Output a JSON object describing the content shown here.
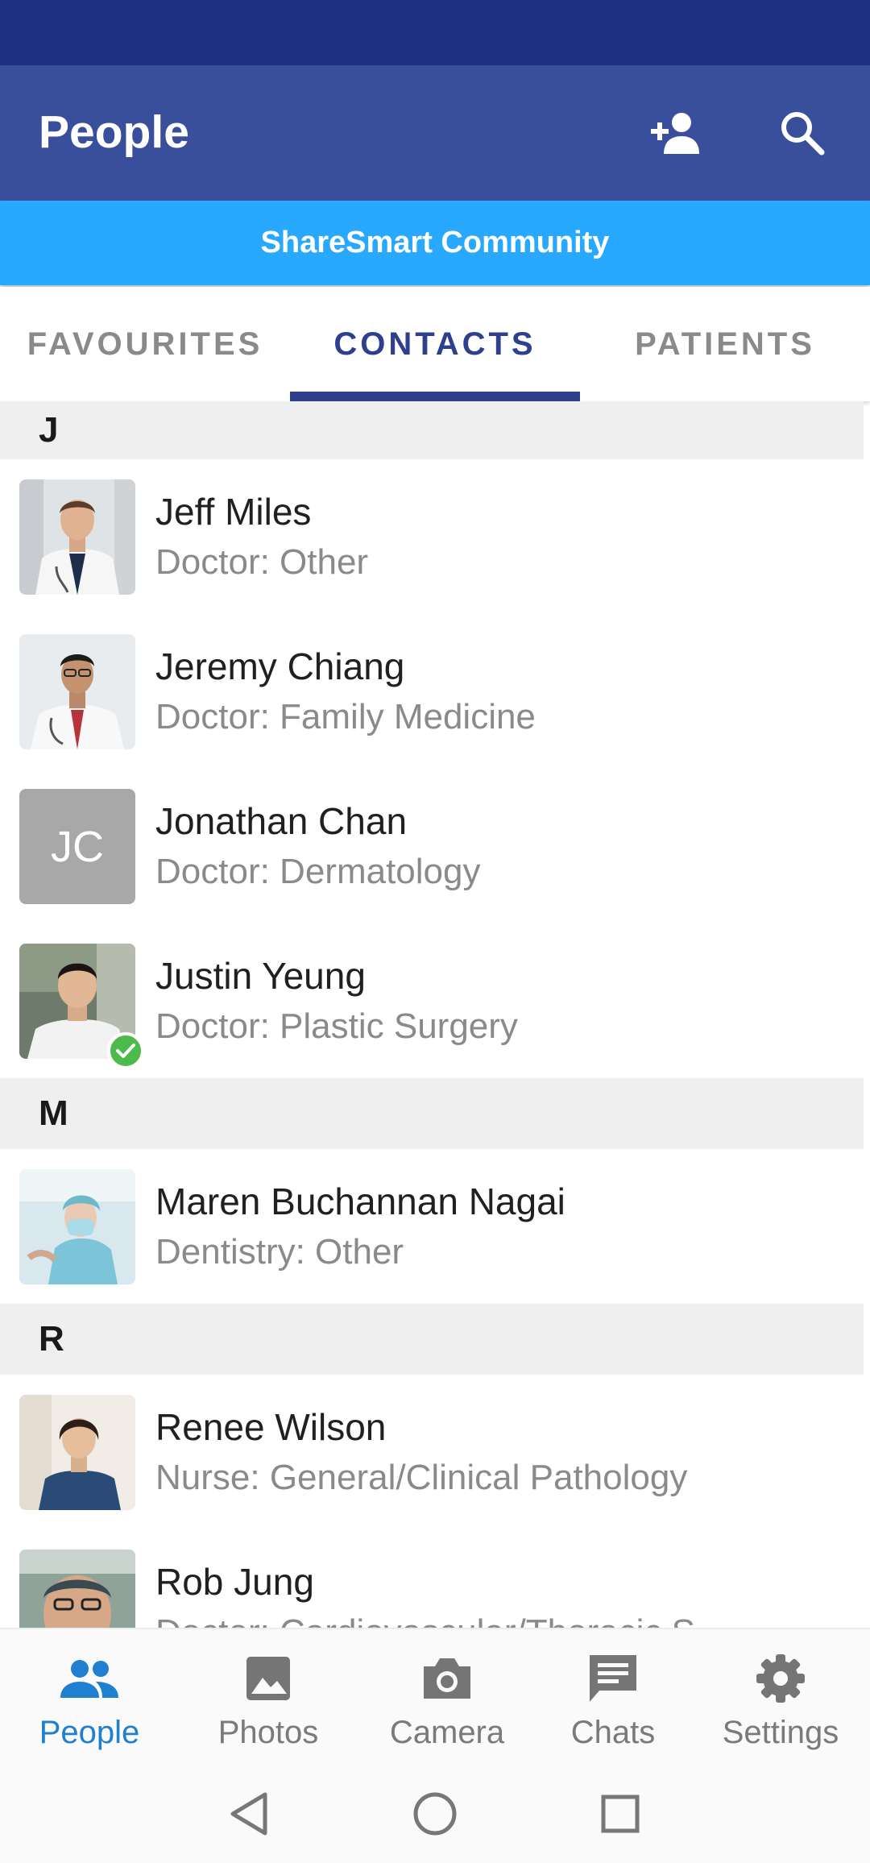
{
  "app_bar": {
    "title": "People",
    "icons": [
      "add-person-icon",
      "search-icon"
    ]
  },
  "banner": {
    "text": "ShareSmart Community"
  },
  "tabs": [
    {
      "label": "FAVOURITES",
      "active": false
    },
    {
      "label": "CONTACTS",
      "active": true
    },
    {
      "label": "PATIENTS",
      "active": false
    }
  ],
  "contacts": {
    "sections": [
      {
        "letter": "J",
        "items": [
          {
            "name": "Jeff Miles",
            "role": "Doctor: Other",
            "avatar": "photo"
          },
          {
            "name": "Jeremy Chiang",
            "role": "Doctor: Family Medicine",
            "avatar": "photo"
          },
          {
            "name": "Jonathan Chan",
            "role": "Doctor: Dermatology",
            "avatar": "initials",
            "initials": "JC"
          },
          {
            "name": "Justin Yeung",
            "role": "Doctor: Plastic Surgery",
            "avatar": "photo",
            "verified": true
          }
        ]
      },
      {
        "letter": "M",
        "items": [
          {
            "name": "Maren Buchannan Nagai",
            "role": "Dentistry: Other",
            "avatar": "photo"
          }
        ]
      },
      {
        "letter": "R",
        "items": [
          {
            "name": "Renee Wilson",
            "role": "Nurse: General/Clinical Pathology",
            "avatar": "photo"
          },
          {
            "name": "Rob Jung",
            "role": "Doctor: Cardiovascular/Thoracic S...",
            "avatar": "photo"
          }
        ]
      }
    ]
  },
  "bottom_nav": [
    {
      "label": "People",
      "icon": "people-icon",
      "active": true
    },
    {
      "label": "Photos",
      "icon": "photo-icon",
      "active": false
    },
    {
      "label": "Camera",
      "icon": "camera-icon",
      "active": false
    },
    {
      "label": "Chats",
      "icon": "chat-icon",
      "active": false
    },
    {
      "label": "Settings",
      "icon": "gear-icon",
      "active": false
    }
  ],
  "system_nav": [
    "back-icon",
    "home-icon",
    "recents-icon"
  ],
  "colors": {
    "status_bar": "#1f2f7f",
    "app_bar": "#3a4f9c",
    "banner": "#29a8ff",
    "tab_active": "#2e3f8e",
    "nav_active": "#1f7fd0",
    "verified_badge": "#4cbb4c"
  }
}
